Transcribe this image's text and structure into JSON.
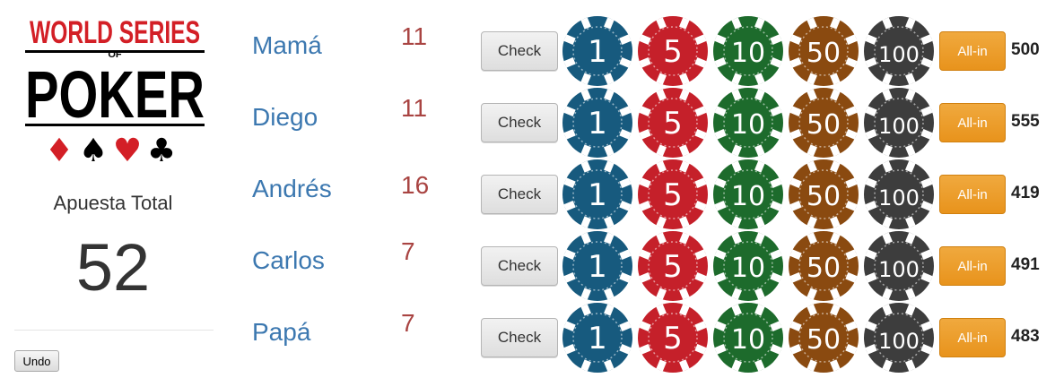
{
  "logo": {
    "line1": "WORLD SERIES",
    "line2": "OF",
    "line3": "POKER",
    "suits": [
      "♦",
      "♠",
      "♥",
      "♣"
    ]
  },
  "summary": {
    "total_label": "Apuesta Total",
    "total_value": "52",
    "undo_label": "Undo"
  },
  "buttons": {
    "check_label": "Check",
    "allin_label": "All-in"
  },
  "chips": [
    {
      "value": "1",
      "color": "#175a7e"
    },
    {
      "value": "5",
      "color": "#c5202a"
    },
    {
      "value": "10",
      "color": "#1d6b2c"
    },
    {
      "value": "50",
      "color": "#8a4a10"
    },
    {
      "value": "100",
      "color": "#3d3d3d"
    }
  ],
  "players": [
    {
      "name": "Mamá",
      "bet": "11",
      "stack": "500"
    },
    {
      "name": "Diego",
      "bet": "11",
      "stack": "555"
    },
    {
      "name": "Andrés",
      "bet": "16",
      "stack": "419"
    },
    {
      "name": "Carlos",
      "bet": "7",
      "stack": "491"
    },
    {
      "name": "Papá",
      "bet": "7",
      "stack": "483"
    }
  ]
}
